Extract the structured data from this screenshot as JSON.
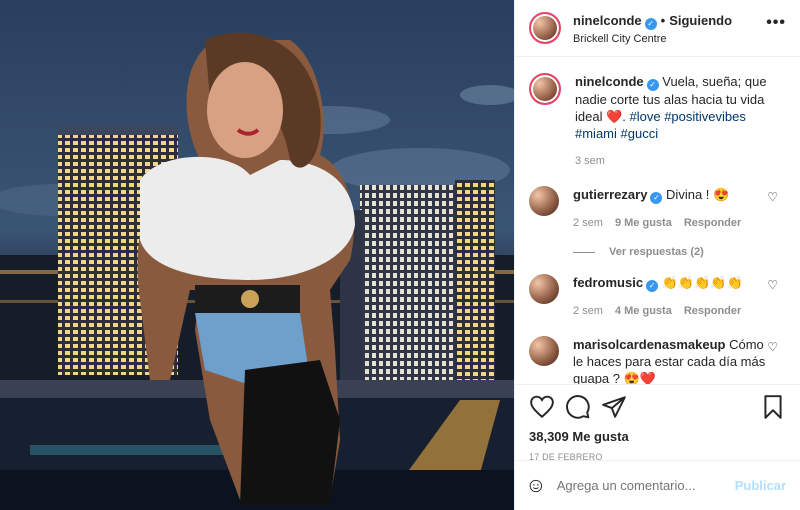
{
  "header": {
    "username": "ninelconde",
    "separator": "•",
    "follow_status": "Siguiendo",
    "location": "Brickell City Centre",
    "more": "•••"
  },
  "caption": {
    "username": "ninelconde",
    "text": "Vuela, sueña; que nadie corte tus alas hacia tu vida ideal ❤️. ",
    "tags": "#love #positivevibes #miami #gucci",
    "time": "3 sem"
  },
  "comments": [
    {
      "username": "gutierrezary",
      "verified": true,
      "text": "Divina ! 😍",
      "time": "2 sem",
      "likes": "9 Me gusta",
      "reply": "Responder"
    },
    {
      "username": "fedromusic",
      "verified": true,
      "text": "👏👏👏👏👏",
      "time": "2 sem",
      "likes": "4 Me gusta",
      "reply": "Responder"
    },
    {
      "username": "marisolcardenasmakeup",
      "verified": false,
      "text": "Cómo le haces para estar cada día más guapa ? 😍❤️",
      "time": "",
      "likes": "",
      "reply": ""
    }
  ],
  "view_replies": "Ver respuestas (2)",
  "actions": {
    "likes": "38,309 Me gusta",
    "date": "17 DE FEBRERO"
  },
  "add_comment": {
    "placeholder": "Agrega un comentario...",
    "publish": "Publicar"
  },
  "icons": [
    "heart-icon",
    "comment-icon",
    "share-icon",
    "bookmark-icon",
    "emoji-icon"
  ],
  "colors": {
    "verified": "#3897f0",
    "link": "#00376b",
    "publish": "#b2dffc"
  }
}
